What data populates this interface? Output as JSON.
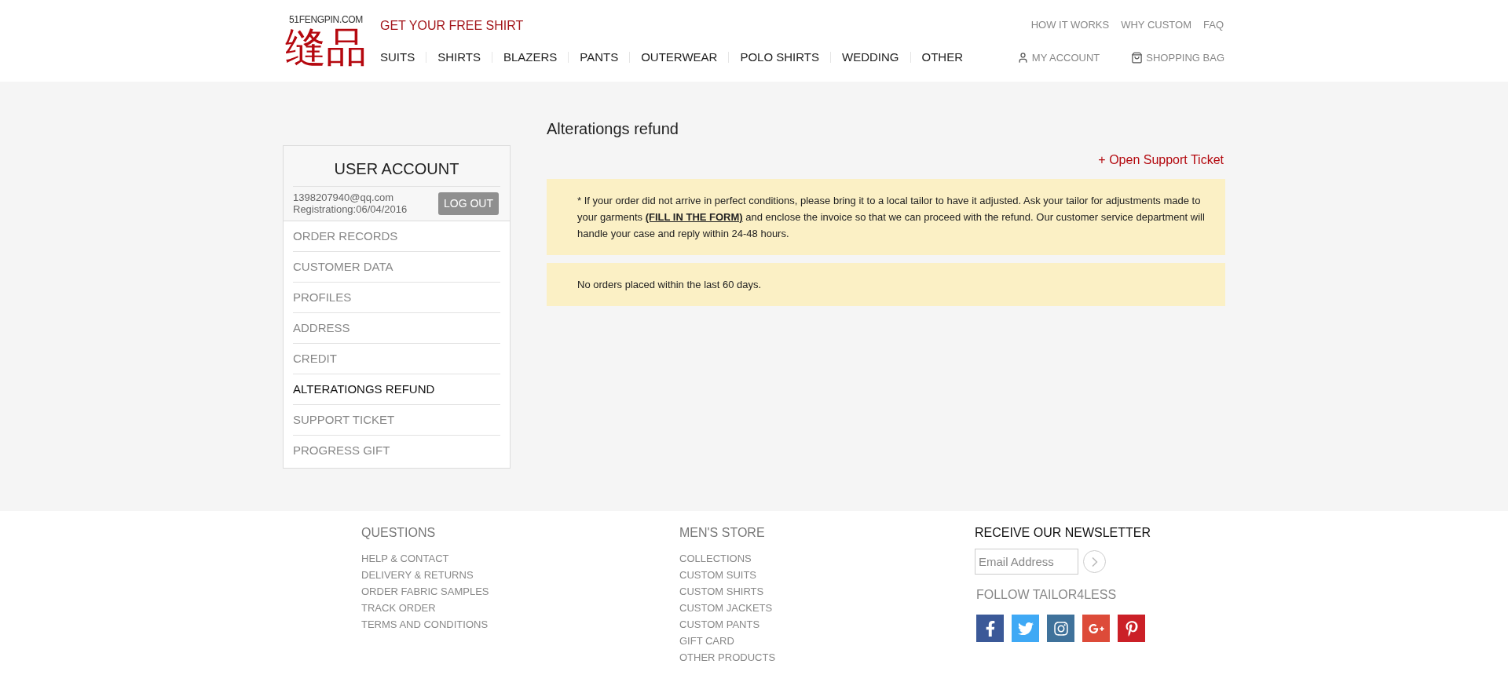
{
  "header": {
    "logo": {
      "domain": "51FENGPIN.COM",
      "name": "缝品"
    },
    "promo": "GET YOUR FREE SHIRT",
    "top_links": [
      "HOW IT WORKS",
      "WHY CUSTOM",
      "FAQ"
    ],
    "nav": [
      "SUITS",
      "SHIRTS",
      "BLAZERS",
      "PANTS",
      "OUTERWEAR",
      "POLO SHIRTS",
      "WEDDING",
      "OTHER"
    ],
    "account_links": [
      {
        "kind": "account",
        "label": "MY ACCOUNT"
      },
      {
        "kind": "bag",
        "label": "SHOPPING BAG"
      }
    ]
  },
  "sidebar": {
    "title": "USER ACCOUNT",
    "email": "1398207940@qq.com",
    "registration": "Registrationg:06/04/2016",
    "logout_button": "LOG OUT",
    "items": [
      {
        "label": "ORDER RECORDS",
        "selected": false
      },
      {
        "label": "CUSTOMER DATA",
        "selected": false
      },
      {
        "label": "PROFILES",
        "selected": false
      },
      {
        "label": "ADDRESS",
        "selected": false
      },
      {
        "label": "CREDIT",
        "selected": false
      },
      {
        "label": "ALTERATIONGS REFUND",
        "selected": true
      },
      {
        "label": "SUPPORT TICKET",
        "selected": false
      },
      {
        "label": "PROGRESS GIFT",
        "selected": false
      }
    ]
  },
  "main": {
    "title": "Alterationgs refund",
    "open_ticket": "+ Open Support Ticket",
    "notices": [
      {
        "before": "* If your order did not arrive in perfect conditions, please bring it to a local tailor to have it adjusted. Ask your tailor for adjustments made to your garments ",
        "link": "(FILL IN THE FORM)",
        "after": " and enclose the invoice so that we can proceed with the refund. Our customer service department will handle your case and reply within 24-48 hours."
      },
      {
        "before": "No orders placed within the last 60 days."
      }
    ]
  },
  "footer": {
    "columns": [
      {
        "title": "QUESTIONS",
        "links": [
          "HELP & CONTACT",
          "DELIVERY & RETURNS",
          "ORDER FABRIC SAMPLES",
          "TRACK ORDER",
          "TERMS AND CONDITIONS"
        ]
      },
      {
        "title": "MEN'S STORE",
        "links": [
          "COLLECTIONS",
          "CUSTOM SUITS",
          "CUSTOM SHIRTS",
          "CUSTOM JACKETS",
          "CUSTOM PANTS",
          "GIFT CARD",
          "OTHER PRODUCTS"
        ]
      }
    ],
    "newsletter": {
      "title": "RECEIVE OUR NEWSLETTER",
      "placeholder": "Email Address"
    },
    "follow": "FOLLOW TAILOR4LESS",
    "social": [
      {
        "kind": "facebook"
      },
      {
        "kind": "twitter"
      },
      {
        "kind": "instagram"
      },
      {
        "kind": "googleplus"
      },
      {
        "kind": "pinterest"
      }
    ]
  }
}
